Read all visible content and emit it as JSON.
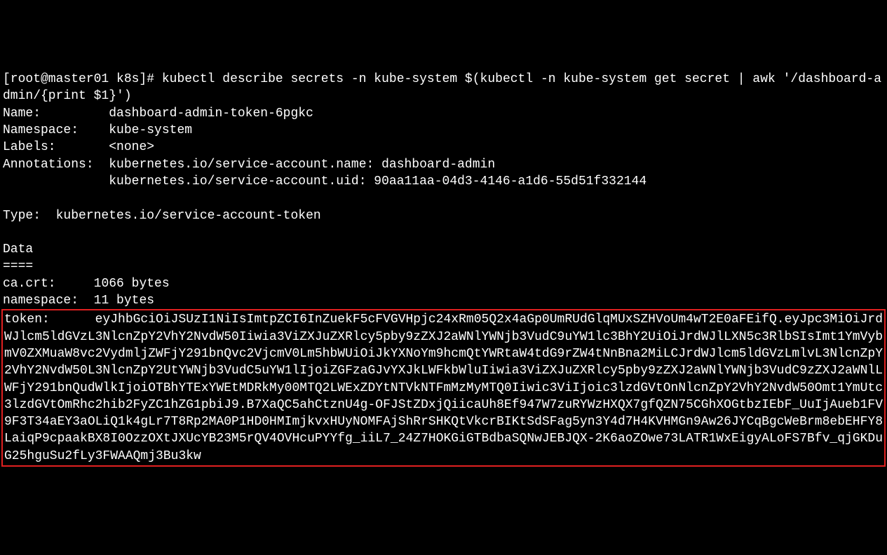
{
  "prompt": {
    "user_host": "[root@master01 k8s]#",
    "command": "kubectl describe secrets -n kube-system $(kubectl -n kube-system get secret | awk '/dashboard-admin/{print $1}')"
  },
  "fields": {
    "name_label": "Name:",
    "name_value": "dashboard-admin-token-6pgkc",
    "namespace_label": "Namespace:",
    "namespace_value": "kube-system",
    "labels_label": "Labels:",
    "labels_value": "<none>",
    "annotations_label": "Annotations:",
    "annotations_value1": "kubernetes.io/service-account.name: dashboard-admin",
    "annotations_value2": "kubernetes.io/service-account.uid: 90aa11aa-04d3-4146-a1d6-55d51f332144"
  },
  "type": {
    "label": "Type:",
    "value": "kubernetes.io/service-account-token"
  },
  "data_section": {
    "heading": "Data",
    "divider": "====",
    "ca_crt_label": "ca.crt:",
    "ca_crt_value": "1066 bytes",
    "namespace_label": "namespace:",
    "namespace_value": "11 bytes"
  },
  "token": {
    "label": "token:",
    "value": "eyJhbGciOiJSUzI1NiIsImtpZCI6InZuekF5cFVGVHpjc24xRm05Q2x4aGp0UmRUdGlqMUxSZHVoUm4wT2E0aFEifQ.eyJpc3MiOiJrdWJlcm5ldGVzL3NlcnZpY2VhY2NvdW50Iiwia3ViZXJuZXRlcy5pby9zZXJ2aWNlYWNjb3VudC9uYW1lc3BhY2UiOiJrdWJlLXN5c3RlbSIsImt1YmVybmV0ZXMuaW8vc2VydmljZWFjY291bnQvc2VjcmV0Lm5hbWUiOiJkYXNoYm9hcmQtYWRtaW4tdG9rZW4tNnBna2MiLCJrdWJlcm5ldGVzLmlvL3NlcnZpY2VhY2NvdW50L3NlcnZpY2UtYWNjb3VudC5uYW1lIjoiZGFzaGJvYXJkLWFkbWluIiwia3ViZXJuZXRlcy5pby9zZXJ2aWNlYWNjb3VudC9zZXJ2aWNlLWFjY291bnQudWlkIjoiOTBhYTExYWEtMDRkMy00MTQ2LWExZDYtNTVkNTFmMzMyMTQ0Iiwic3ViIjoic3lzdGVtOnNlcnZpY2VhY2NvdW50Omt1YmUtc3lzdGVtOmRhc2hib2FyZC1hZG1pbiJ9.B7XaQC5ahCtznU4g-OFJStZDxjQiicaUh8Ef947W7zuRYWzHXQX7gfQZN75CGhXOGtbzIEbF_UuIjAueb1FV9F3T34aEY3aOLiQ1k4gLr7T8Rp2MA0P1HD0HMImjkvxHUyNOMFAjShRrSHKQtVkcrBIKtSdSFag5yn3Y4d7H4KVHMGn9Aw26JYCqBgcWeBrm8ebEHFY8LaiqP9cpaakBX8I0OzzOXtJXUcYB23M5rQV4OVHcuPYYfg_iiL7_24Z7HOKGiGTBdbaSQNwJEBJQX-2K6aoZOwe73LATR1WxEigyALoFS7Bfv_qjGKDuG25hguSu2fLy3FWAAQmj3Bu3kw"
  }
}
